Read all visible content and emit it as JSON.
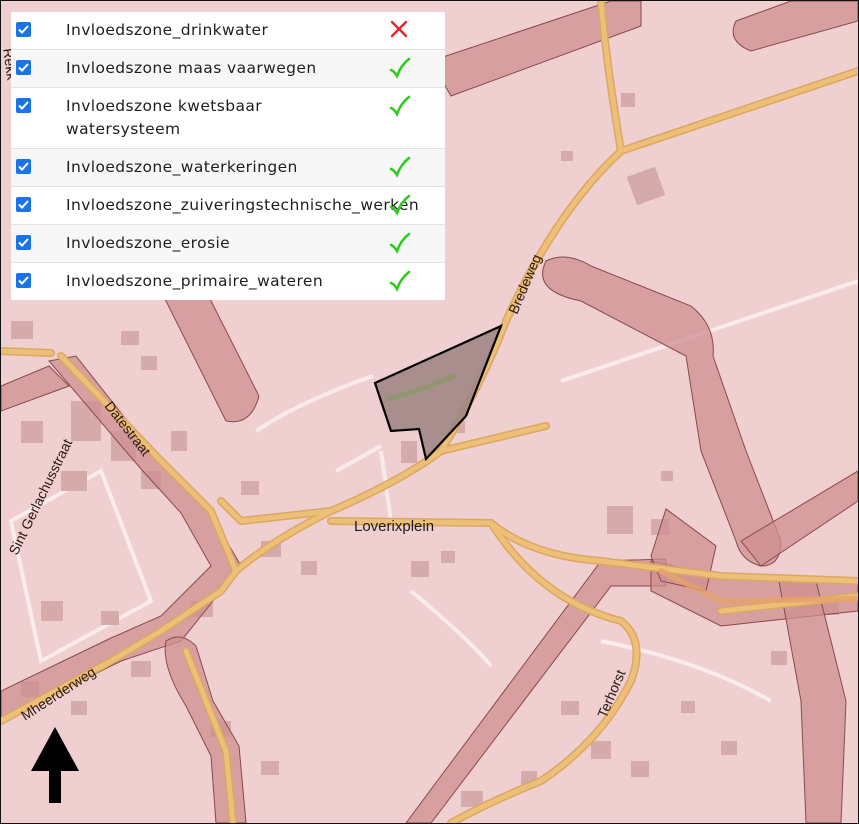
{
  "legend": {
    "layers": [
      {
        "label": "Invloedszone_drinkwater",
        "checked": true,
        "status": "cross-icon"
      },
      {
        "label": "Invloedszone maas vaarwegen",
        "checked": true,
        "status": "check-icon"
      },
      {
        "label": "Invloedszone kwetsbaar watersysteem",
        "checked": true,
        "status": "check-icon"
      },
      {
        "label": "Invloedszone_waterkeringen",
        "checked": true,
        "status": "check-icon"
      },
      {
        "label": "Invloedszone_zuiveringstechnische_werken",
        "checked": true,
        "status": "check-icon"
      },
      {
        "label": "Invloedszone_erosie",
        "checked": true,
        "status": "check-icon"
      },
      {
        "label": "Invloedszone_primaire_wateren",
        "checked": true,
        "status": "check-icon"
      }
    ]
  },
  "map": {
    "labels": {
      "bredeweg": "Bredeweg",
      "datestraat": "Datestraat",
      "sint_gerlachus": "Sint Gerlachusstraat",
      "loverixplein": "Loverixplein",
      "mheerderweg": "Mheerderweg",
      "terhorst": "Terhorst",
      "edge_partial": "Rekk"
    },
    "colors": {
      "background": "#efcfcf",
      "zone": "#cf8f90",
      "road": "#eabb72",
      "parcel": "#9c8282",
      "check": "#2ecc1e",
      "cross": "#e8242a"
    }
  },
  "north_arrow": {
    "icon": "north-arrow-icon"
  }
}
